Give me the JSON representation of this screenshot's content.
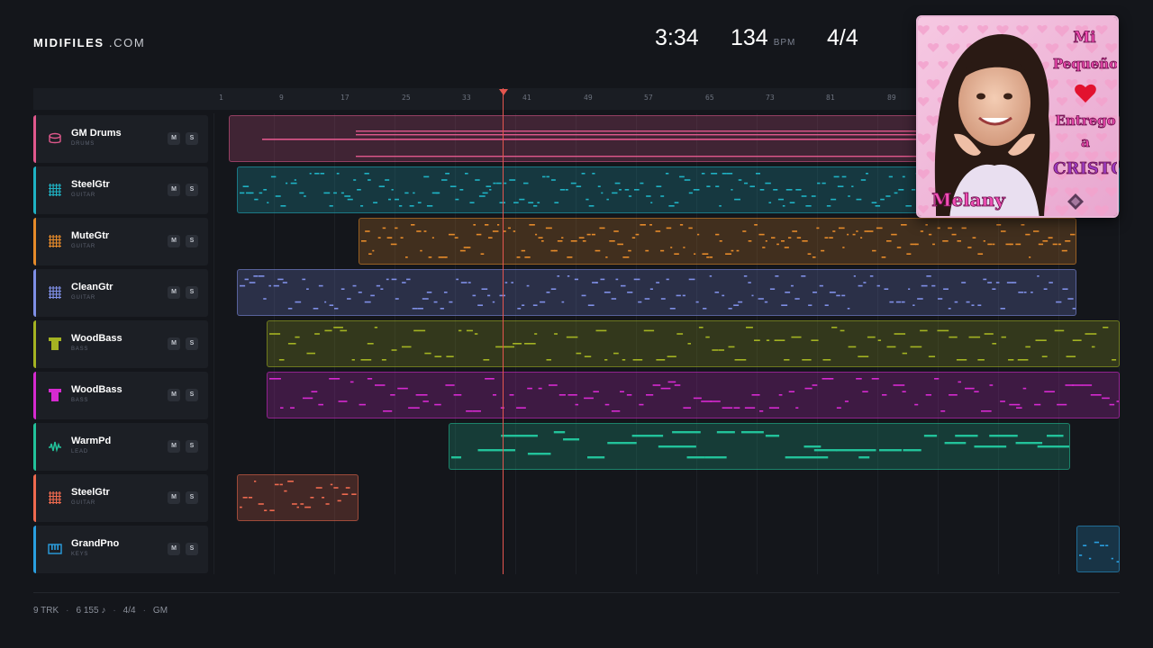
{
  "brand": {
    "name_bold": "MIDIFILES",
    "name_light": ".COM"
  },
  "transport": {
    "time": "3:34",
    "bpm": "134",
    "bpm_label": "BPM",
    "signature": "4/4"
  },
  "ruler": [
    "1",
    "9",
    "17",
    "25",
    "33",
    "41",
    "49",
    "57",
    "65",
    "73",
    "81",
    "89"
  ],
  "tracks": [
    {
      "name": "GM Drums",
      "sub": "DRUMS",
      "icon": "drum-icon",
      "color": "#e0588c",
      "mute": "M",
      "solo": "S"
    },
    {
      "name": "SteelGtr",
      "sub": "GUITAR",
      "icon": "guitar-icon",
      "color": "#1fb2c4",
      "mute": "M",
      "solo": "S"
    },
    {
      "name": "MuteGtr",
      "sub": "GUITAR",
      "icon": "guitar-icon",
      "color": "#e58a2a",
      "mute": "M",
      "solo": "S"
    },
    {
      "name": "CleanGtr",
      "sub": "GUITAR",
      "icon": "guitar-icon",
      "color": "#7f8fe6",
      "mute": "M",
      "solo": "S"
    },
    {
      "name": "WoodBass",
      "sub": "BASS",
      "icon": "bass-icon",
      "color": "#a4b322",
      "mute": "M",
      "solo": "S"
    },
    {
      "name": "WoodBass",
      "sub": "BASS",
      "icon": "bass-icon",
      "color": "#d62ad0",
      "mute": "M",
      "solo": "S"
    },
    {
      "name": "WarmPd",
      "sub": "LEAD",
      "icon": "wave-icon",
      "color": "#22c29a",
      "mute": "M",
      "solo": "S"
    },
    {
      "name": "SteelGtr",
      "sub": "GUITAR",
      "icon": "guitar-icon",
      "color": "#ef6a4f",
      "mute": "M",
      "solo": "S"
    },
    {
      "name": "GrandPno",
      "sub": "KEYS",
      "icon": "keys-icon",
      "color": "#2a9fe0",
      "mute": "M",
      "solo": "S"
    }
  ],
  "cover": {
    "line1": "Mi",
    "line2": "Pequeño",
    "line3": "Entrego",
    "line4": "a",
    "line5": "CRISTO",
    "artist": "Melany"
  },
  "footer": {
    "tracks": "9 TRK",
    "notes": "6 155 ♪",
    "signature": "4/4",
    "standard": "GM"
  }
}
